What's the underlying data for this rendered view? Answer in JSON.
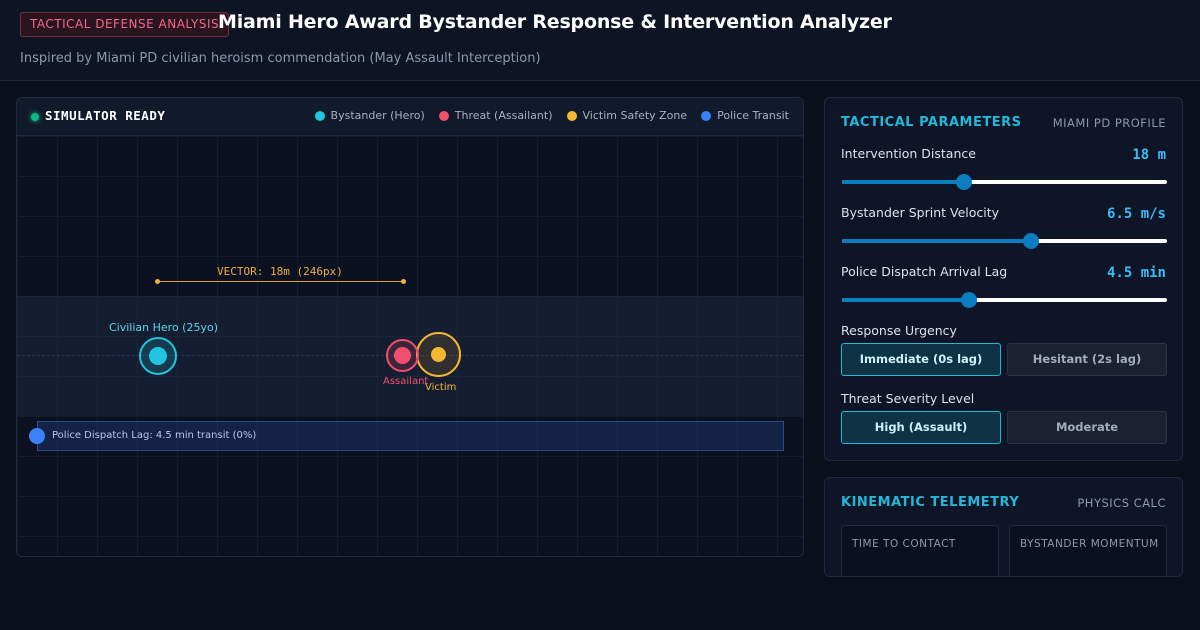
{
  "header": {
    "badge": "TACTICAL DEFENSE ANALYSIS",
    "title": "Miami Hero Award Bystander Response & Intervention Analyzer",
    "subtitle": "Inspired by Miami PD civilian heroism commendation (May Assault Interception)"
  },
  "simulator": {
    "status": "SIMULATOR READY",
    "legend": [
      {
        "label": "Bystander (Hero)",
        "color": "#22c5e0"
      },
      {
        "label": "Threat (Assailant)",
        "color": "#f0506e"
      },
      {
        "label": "Victim Safety Zone",
        "color": "#f5b731"
      },
      {
        "label": "Police Transit",
        "color": "#3b82f6"
      }
    ],
    "vector_label": "VECTOR: 18m (246px)",
    "hero_label": "Civilian Hero (25yo)",
    "threat_label": "Assailant",
    "victim_label": "Victim",
    "dispatch_label": "Police Dispatch Lag: 4.5 min transit (0%)"
  },
  "parameters": {
    "title": "TACTICAL PARAMETERS",
    "profile": "MIAMI PD PROFILE",
    "distance": {
      "label": "Intervention Distance",
      "value": "18 m",
      "fraction": 0.375
    },
    "velocity": {
      "label": "Bystander Sprint Velocity",
      "value": "6.5 m/s",
      "fraction": 0.58
    },
    "lag": {
      "label": "Police Dispatch Arrival Lag",
      "value": "4.5 min",
      "fraction": 0.39
    },
    "urgency": {
      "label": "Response Urgency",
      "options": [
        "Immediate (0s lag)",
        "Hesitant (2s lag)"
      ],
      "selected": 0
    },
    "severity": {
      "label": "Threat Severity Level",
      "options": [
        "High (Assault)",
        "Moderate"
      ],
      "selected": 0
    }
  },
  "telemetry": {
    "title": "KINEMATIC TELEMETRY",
    "tag": "PHYSICS CALC",
    "boxes": [
      "TIME TO CONTACT",
      "BYSTANDER MOMENTUM"
    ]
  }
}
